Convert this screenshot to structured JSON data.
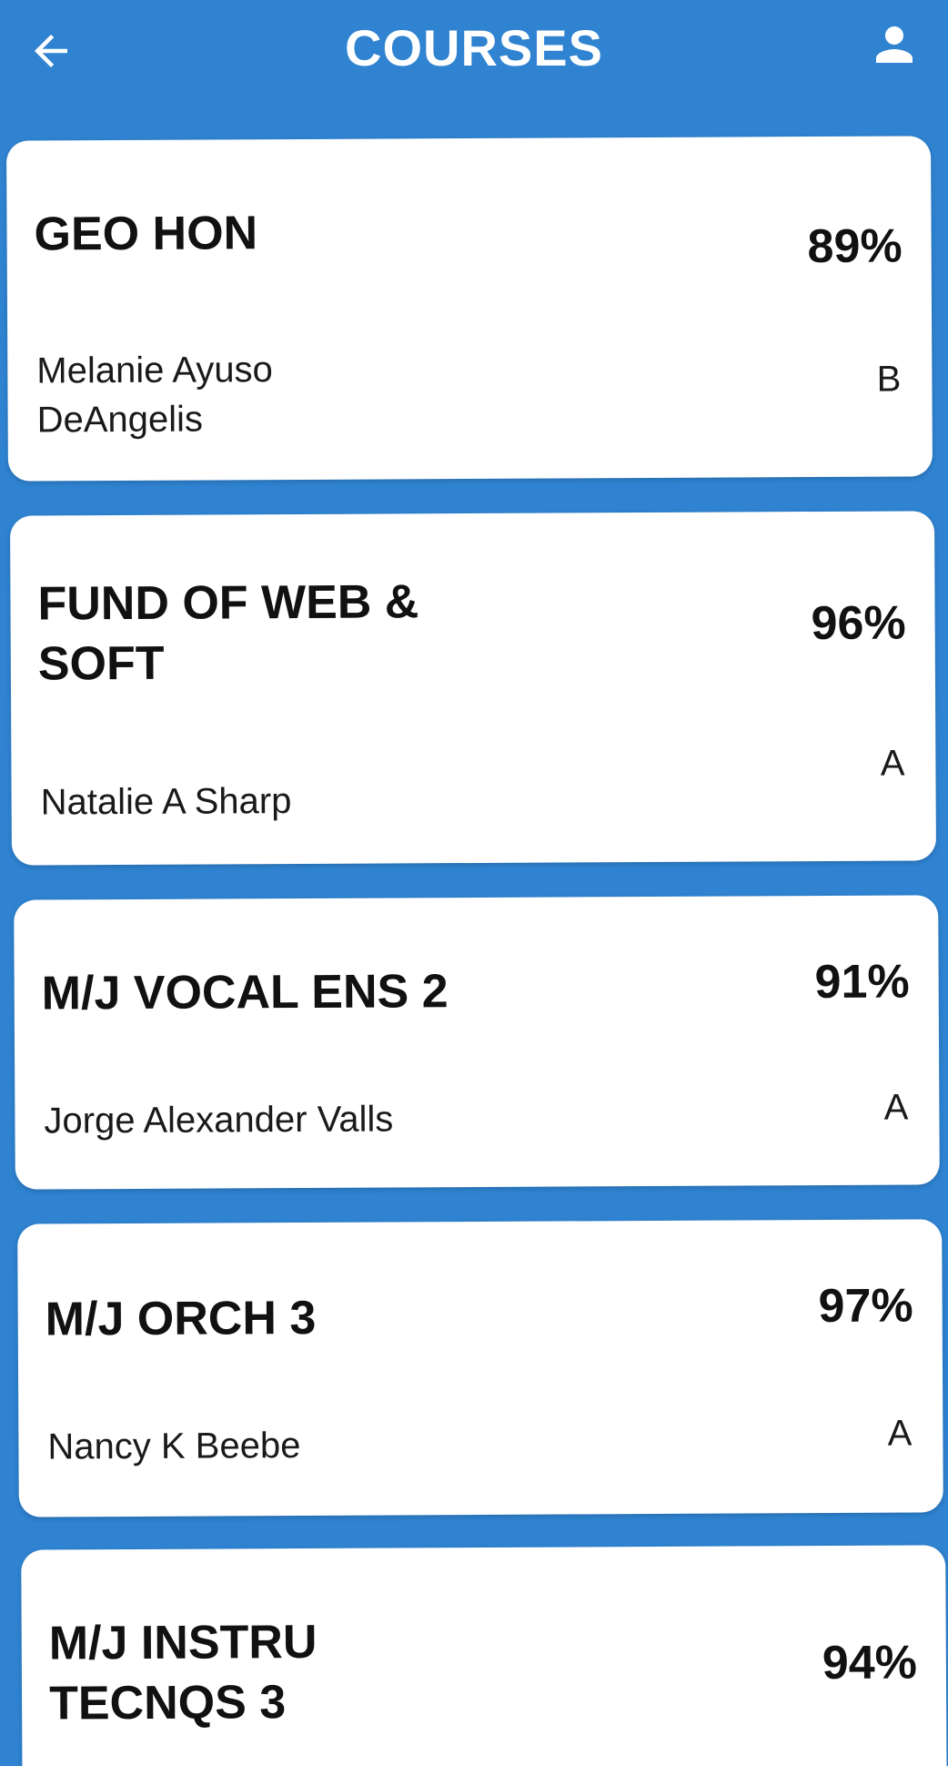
{
  "header": {
    "title": "COURSES",
    "back_icon": "arrow-left-icon",
    "profile_icon": "person-icon"
  },
  "colors": {
    "background": "#2f83d1",
    "card": "#ffffff",
    "text": "#111111"
  },
  "courses": [
    {
      "name": "GEO HON",
      "percent": "89%",
      "teacher": "Melanie Ayuso DeAngelis",
      "letter": "B"
    },
    {
      "name": "FUND OF WEB & SOFT",
      "percent": "96%",
      "teacher": "Natalie A Sharp",
      "letter": "A"
    },
    {
      "name": "M/J VOCAL ENS 2",
      "percent": "91%",
      "teacher": "Jorge Alexander Valls",
      "letter": "A"
    },
    {
      "name": "M/J ORCH 3",
      "percent": "97%",
      "teacher": "Nancy K Beebe",
      "letter": "A"
    },
    {
      "name": "M/J INSTRU TECNQS 3",
      "percent": "94%",
      "teacher": "",
      "letter": ""
    }
  ]
}
